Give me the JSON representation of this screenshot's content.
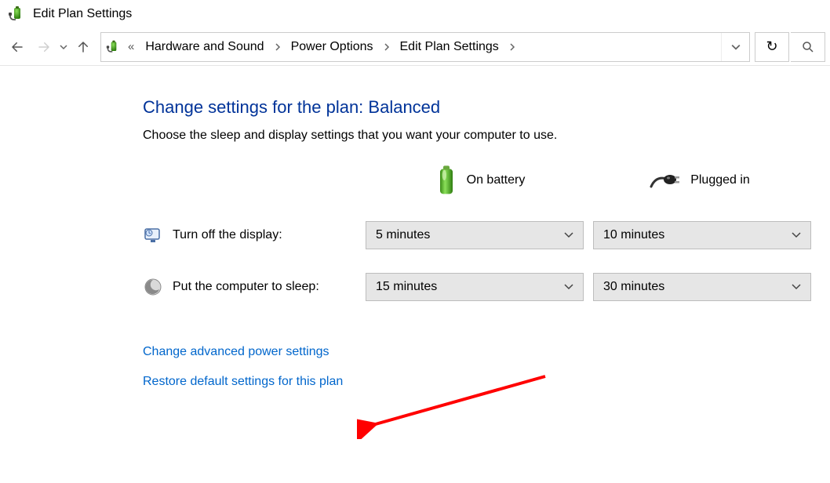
{
  "window": {
    "title": "Edit Plan Settings"
  },
  "breadcrumb": {
    "items": [
      "Hardware and Sound",
      "Power Options",
      "Edit Plan Settings"
    ]
  },
  "page": {
    "heading": "Change settings for the plan: Balanced",
    "subheading": "Choose the sleep and display settings that you want your computer to use.",
    "col_battery": "On battery",
    "col_plugged": "Plugged in"
  },
  "settings": {
    "display": {
      "label": "Turn off the display:",
      "battery": "5 minutes",
      "plugged": "10 minutes"
    },
    "sleep": {
      "label": "Put the computer to sleep:",
      "battery": "15 minutes",
      "plugged": "30 minutes"
    }
  },
  "links": {
    "advanced": "Change advanced power settings",
    "restore": "Restore default settings for this plan"
  }
}
